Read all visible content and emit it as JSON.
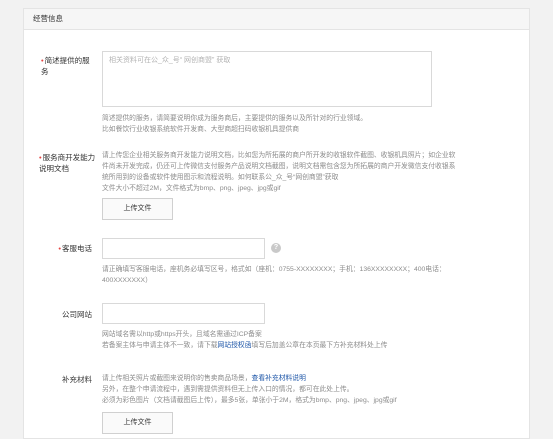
{
  "section_title": "经营信息",
  "service_desc": {
    "label": "简述提供的服务",
    "placeholder": "相关资料可在公_众_号“ 网创商盟” 获取",
    "hints": [
      "简述提供的服务，请简要说明你成为服务商后，主要提供的服务以及所针对的行业领域。",
      "比如餐饮行业收银系统软件开发商、大型商超扫码收银机具提供商"
    ]
  },
  "dev_doc": {
    "label": "服务商开发能力说明文档",
    "hints": [
      "请上传您企业相关服务商开发能力说明文档，比如您为所拓展的商户所开发的收银软件截图、收银机具照片；如企业软",
      "件尚未开发完成，仍还可上传微信支付服务产品说明文档截图，说明文档需包含您为所拓展的商户开发微信支付收银系",
      "统所用到的设备或软件使用图示和流程说明。如何联系公_众_号“网创商盟”获取",
      "文件大小不超过2M，文件格式为bmp、png、jpeg、jpg或gif"
    ],
    "button": "上传文件"
  },
  "phone": {
    "label": "客服电话",
    "help_icon": "?",
    "hints": [
      "请正确填写客服电话，座机务必填写区号，格式如（座机：0755-XXXXXXXX；手机：136XXXXXXXX；400电话：",
      "400XXXXXXX）"
    ]
  },
  "website": {
    "label": "公司网站",
    "hint1": "网站域名需以http或https开头，且域名需通过ICP备案",
    "hint2_pre": "若备案主体与申请主体不一致，请下载",
    "hint2_link": "网站授权函",
    "hint2_post": "填写后加盖公章在本页最下方补充材料处上传"
  },
  "supplement": {
    "label": "补充材料",
    "hint1_pre": "请上传相关照片或截图来说明你的售卖商品场景，",
    "hint1_link": "查看补充材料说明",
    "hint2": "另外，在整个申请流程中，遇到需提供资料但无上传入口的情况，都可在此处上传。",
    "hint3": "必须为彩色图片（文档请截图后上传），最多5张，单张小于2M，格式为bmp、png、jpeg、jpg或gif",
    "button": "上传文件"
  }
}
